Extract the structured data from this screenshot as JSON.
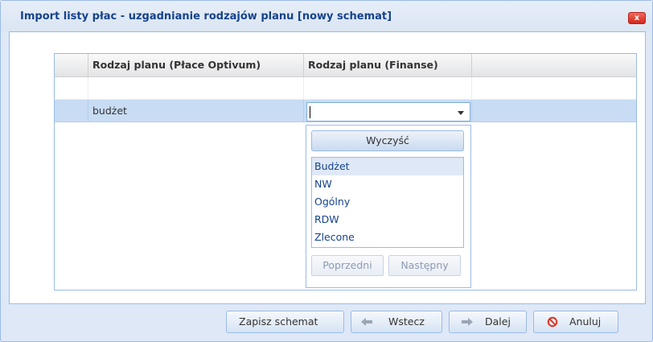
{
  "window": {
    "title": "Import listy płac - uzgadnianie rodzajów planu [nowy schemat]",
    "close_label": "x"
  },
  "grid": {
    "columns": [
      "Rodzaj planu (Płace Optivum)",
      "Rodzaj planu (Finanse)"
    ],
    "rows": [
      {
        "source": "",
        "target": ""
      },
      {
        "source": "budżet",
        "target": ""
      }
    ]
  },
  "combo": {
    "value": "",
    "clear_label": "Wyczyść",
    "options": [
      "Budżet",
      "NW",
      "Ogólny",
      "RDW",
      "Zlecone"
    ],
    "prev_label": "Poprzedni",
    "next_label": "Następny"
  },
  "footer": {
    "save_label": "Zapisz schemat",
    "back_label": "Wstecz",
    "next_label": "Dalej",
    "cancel_label": "Anuluj"
  },
  "colors": {
    "accent": "#15428b",
    "selection": "#c8dcf4",
    "close": "#d3271c",
    "cancel_icon": "#e0301e"
  }
}
